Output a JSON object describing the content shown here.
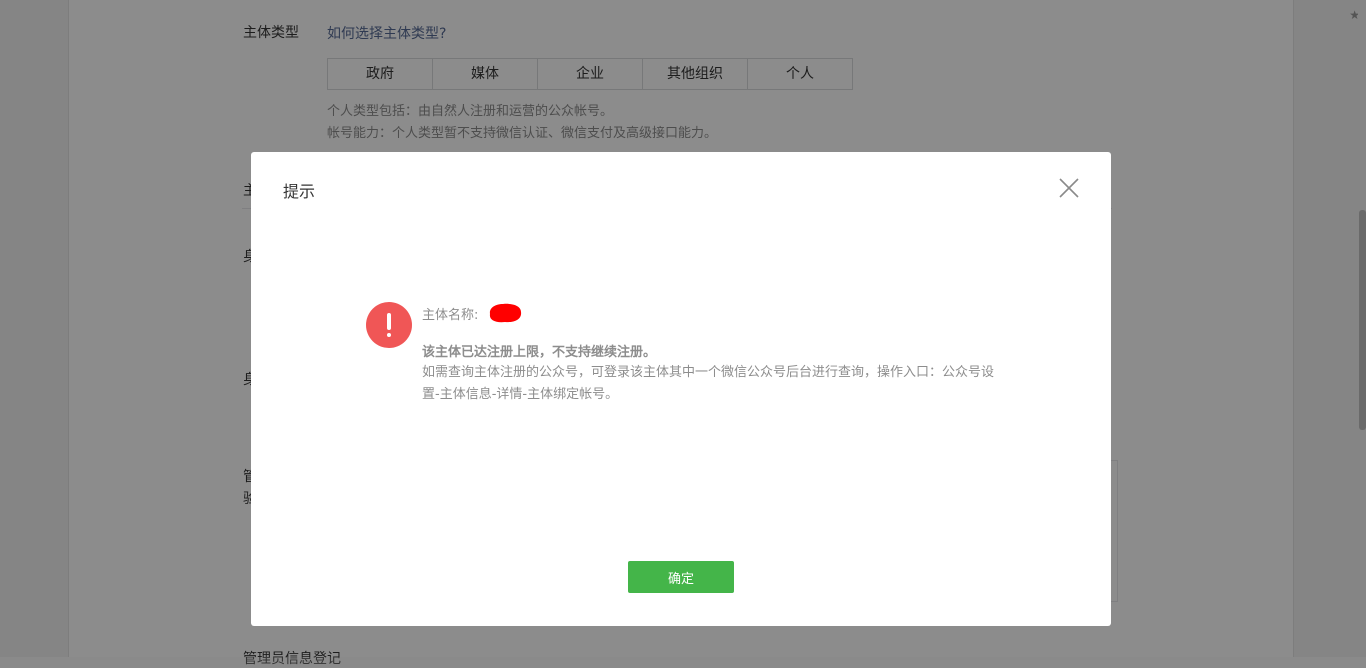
{
  "background": {
    "subject_type_label": "主体类型",
    "how_to_choose_link": "如何选择主体类型?",
    "types": [
      "政府",
      "媒体",
      "企业",
      "其他组织",
      "个人"
    ],
    "desc_line1": "个人类型包括：由自然人注册和运营的公众帐号。",
    "desc_line2": "帐号能力：个人类型暂不支持微信认证、微信支付及高级接口能力。",
    "partial_labels": [
      "主",
      "身",
      "身",
      "管",
      "验"
    ],
    "bottom_label": "管理员信息登记"
  },
  "dialog": {
    "title": "提示",
    "name_label": "主体名称:",
    "strong_message": "该主体已达注册上限，不支持继续注册。",
    "detail_message": "如需查询主体注册的公众号，可登录该主体其中一个微信公众号后台进行查询，操作入口：公众号设置-主体信息-详情-主体绑定帐号。",
    "confirm_label": "确定"
  },
  "colors": {
    "primary_green": "#44b549",
    "warning_red": "#f05656",
    "link_blue": "#576b95",
    "redaction": "#ff0000"
  },
  "icons": {
    "close": "close-icon",
    "warning": "exclamation-icon",
    "star": "star-icon"
  }
}
